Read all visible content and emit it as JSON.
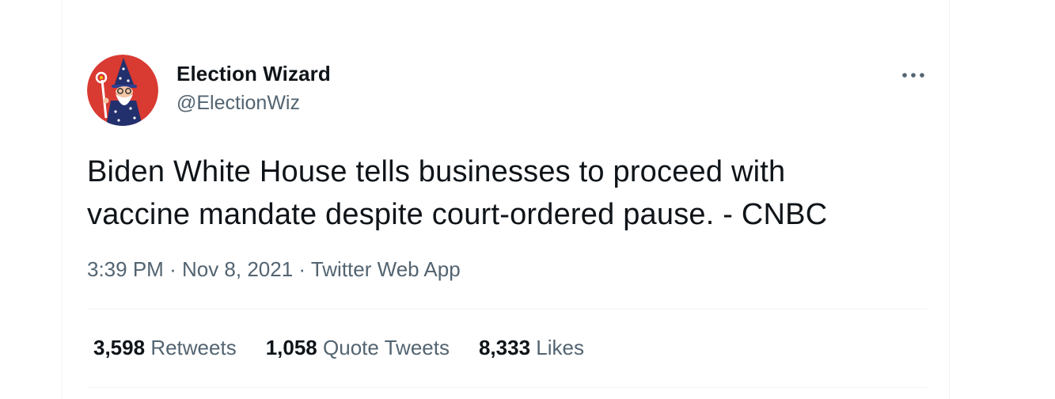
{
  "author": {
    "display_name": "Election Wizard",
    "handle": "@ElectionWiz",
    "avatar_icon": "wizard-avatar-icon"
  },
  "tweet": {
    "text_line1": "Biden White House tells businesses to proceed with",
    "text_line2": "vaccine mandate despite court-ordered pause. - CNBC"
  },
  "meta": {
    "time": "3:39 PM",
    "separator": "·",
    "date": "Nov 8, 2021",
    "source": "Twitter Web App"
  },
  "stats": {
    "retweets": {
      "count": "3,598",
      "label": "Retweets"
    },
    "quote_tweets": {
      "count": "1,058",
      "label": "Quote Tweets"
    },
    "likes": {
      "count": "8,333",
      "label": "Likes"
    }
  },
  "colors": {
    "text_primary": "#0f1419",
    "text_secondary": "#536471",
    "divider": "#eff3f4",
    "avatar_bg": "#d93a32"
  }
}
